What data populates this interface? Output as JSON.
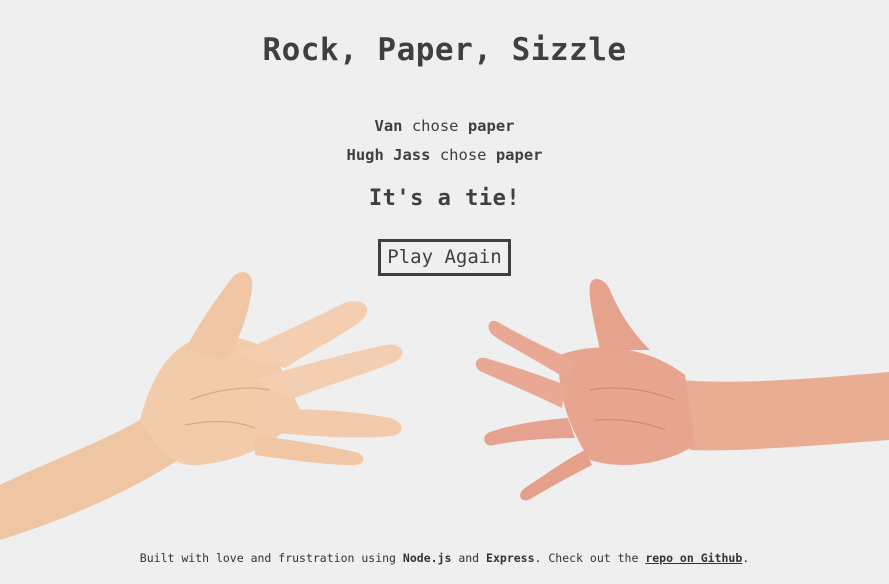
{
  "title": "Rock, Paper, Sizzle",
  "players": [
    {
      "name": "Van",
      "verb": "chose",
      "choice": "paper"
    },
    {
      "name": "Hugh Jass",
      "verb": "chose",
      "choice": "paper"
    }
  ],
  "result": "It's a tie!",
  "play_again_label": "Play Again",
  "footer": {
    "prefix": "Built with love and frustration using",
    "tech1": "Node.js",
    "and": "and",
    "tech2": "Express",
    "middle": ". Check out the",
    "link_text": "repo on Github",
    "suffix": "."
  },
  "colors": {
    "background": "#efefef",
    "text": "#3f3f3f",
    "skin_left": "#f0c9a8",
    "skin_right": "#e6a48f"
  }
}
